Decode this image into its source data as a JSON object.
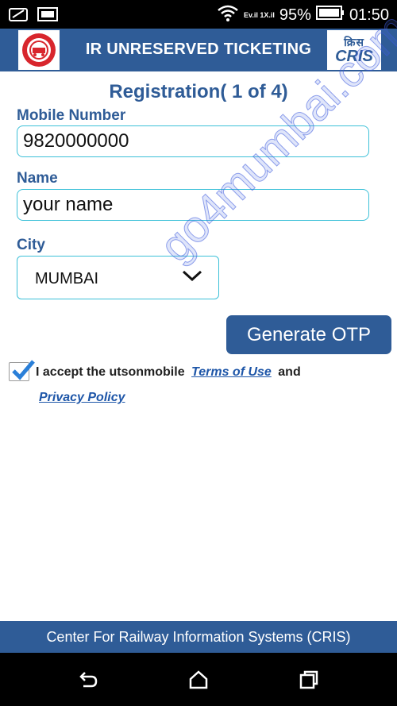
{
  "status_bar": {
    "battery": "95%",
    "time": "01:50",
    "network": "Ev.il 1X.il",
    "icons": [
      "wifi-icon",
      "signal-icon",
      "battery-icon",
      "notification-icon",
      "gallery-icon"
    ]
  },
  "header": {
    "title": "IR UNRESERVED TICKETING",
    "right_logo_hindi": "क्रिस",
    "right_logo_text": "CRIS"
  },
  "form": {
    "page_title": "Registration( 1 of 4)",
    "mobile_label": "Mobile Number",
    "mobile_value": "9820000000",
    "name_label": "Name",
    "name_value": "your name",
    "city_label": "City",
    "city_value": "MUMBAI",
    "otp_button": "Generate OTP"
  },
  "terms": {
    "checked": true,
    "prefix": "I accept the utsonmobile",
    "terms_link": "Terms of Use",
    "and": "and",
    "privacy_link": "Privacy Policy"
  },
  "watermark": "go4mumbai.com",
  "footer": {
    "text": "Center For Railway Information Systems (CRIS)"
  },
  "colors": {
    "primary": "#2f5c97",
    "field_border": "#3cc0d8",
    "link": "#1e56a8"
  }
}
